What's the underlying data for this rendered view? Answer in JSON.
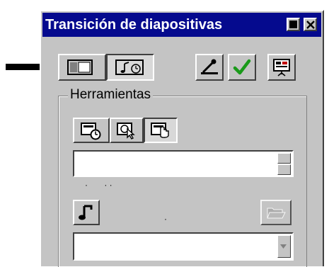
{
  "window": {
    "title": "Transición de diapositivas",
    "maximize_label": "",
    "close_label": ""
  },
  "toolbar": {
    "tabs": [
      {
        "name": "effects-tab-icon",
        "selected": false
      },
      {
        "name": "sound-timing-tab-icon",
        "selected": true
      }
    ],
    "actions": [
      {
        "name": "microphone-icon"
      },
      {
        "name": "checkmark-icon"
      },
      {
        "name": "slide-show-icon"
      }
    ]
  },
  "tools_group": {
    "label": "Herramientas",
    "buttons": [
      {
        "name": "timer-icon",
        "selected": false
      },
      {
        "name": "click-time-icon",
        "selected": false
      },
      {
        "name": "mouse-click-icon",
        "selected": true
      }
    ],
    "time_field": {
      "value": ""
    },
    "sound_field": {
      "value": ""
    }
  },
  "colors": {
    "titlebar": "#050a8e",
    "face": "#c4c4c4",
    "arrow": "#000000",
    "check": "#1a9a1a"
  }
}
